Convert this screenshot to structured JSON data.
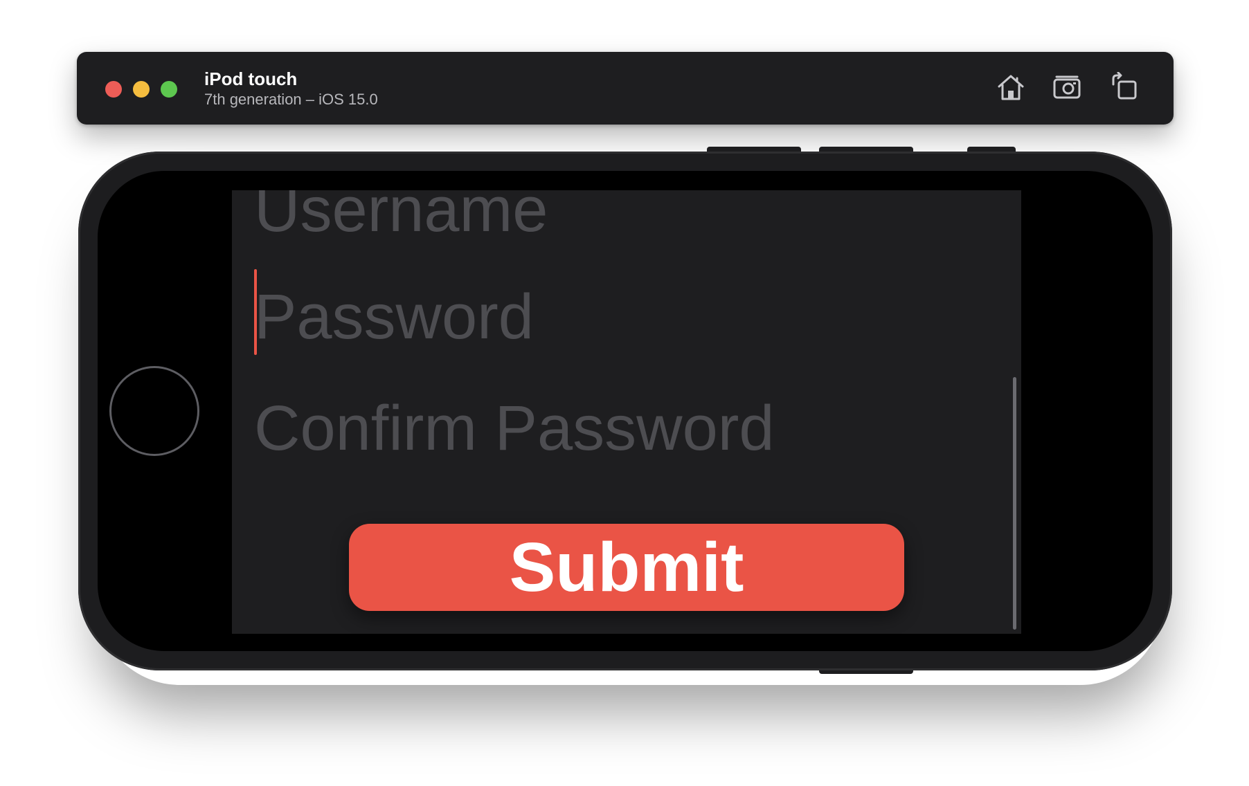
{
  "window": {
    "device_name": "iPod touch",
    "device_subtitle": "7th generation – iOS 15.0",
    "toolbar": {
      "home_icon": "home-icon",
      "screenshot_icon": "camera-icon",
      "rotate_icon": "rotate-icon"
    }
  },
  "form": {
    "username_placeholder": "Username",
    "password_placeholder": "Password",
    "confirm_password_placeholder": "Confirm Password",
    "submit_label": "Submit"
  },
  "colors": {
    "accent": "#ea5446",
    "screen_background": "#1e1e20",
    "placeholder_text": "#4d4d51",
    "titlebar_background": "#1e1e20"
  }
}
